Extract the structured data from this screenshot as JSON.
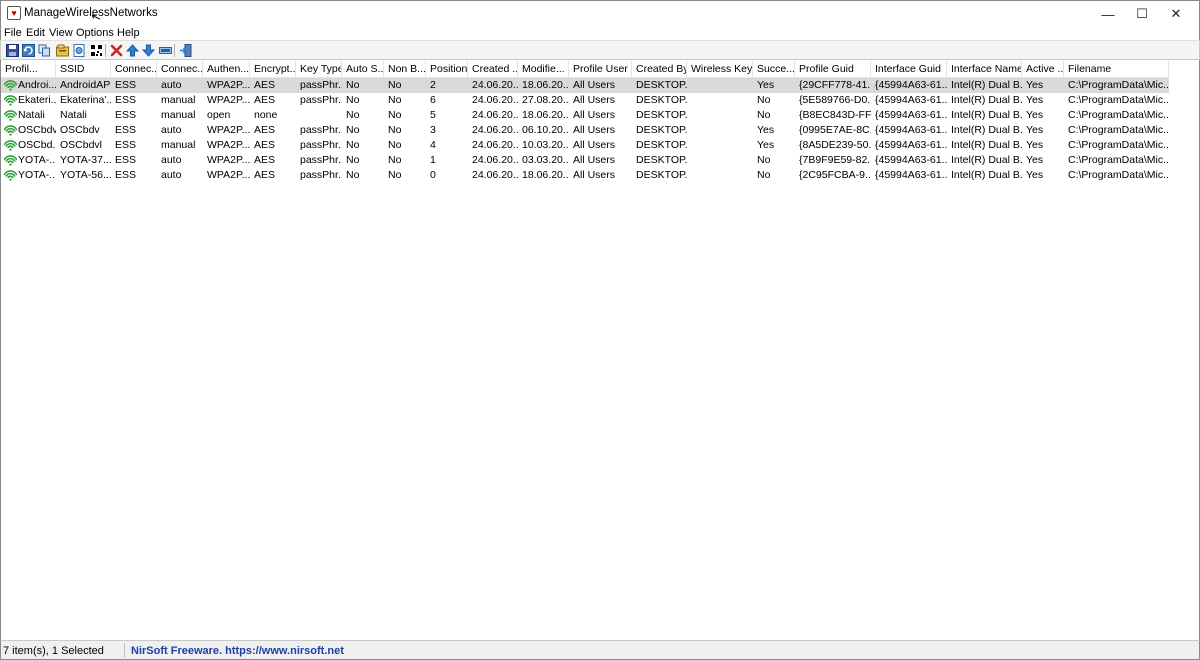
{
  "window": {
    "title": "ManageWirelessNetworks",
    "minimize_glyph": "—",
    "maximize_glyph": "☐",
    "close_glyph": "✕"
  },
  "menu": [
    "File",
    "Edit",
    "View",
    "Options",
    "Help"
  ],
  "toolbar": {
    "icons": [
      "save-icon",
      "refresh-icon",
      "copy-icon",
      "properties-icon",
      "html-report-icon",
      "qr-code-icon",
      "delete-icon",
      "move-up-icon",
      "move-down-icon",
      "connect-icon",
      "exit-icon"
    ]
  },
  "columns": [
    "Profil...",
    "SSID",
    "Connec...",
    "Connec...",
    "Authen...",
    "Encrypt...",
    "Key Type",
    "Auto S...",
    "Non B...",
    "Position",
    "Created ...",
    "Modifie...",
    "Profile User",
    "Created By",
    "Wireless Key",
    "Succe...",
    "Profile Guid",
    "Interface Guid",
    "Interface Name",
    "Active ...",
    "Filename"
  ],
  "rows": [
    {
      "selected": true,
      "cells": [
        "Androi...",
        "AndroidAP",
        "ESS",
        "auto",
        "WPA2P...",
        "AES",
        "passPhr...",
        "No",
        "No",
        "2",
        "24.06.20...",
        "18.06.20...",
        "All Users",
        "DESKTOP...",
        "",
        "Yes",
        "{29CFF778-41...",
        "{45994A63-61...",
        "Intel(R) Dual B...",
        "Yes",
        "C:\\ProgramData\\Mic..."
      ]
    },
    {
      "selected": false,
      "cells": [
        "Ekateri...",
        "Ekaterina'...",
        "ESS",
        "manual",
        "WPA2P...",
        "AES",
        "passPhr...",
        "No",
        "No",
        "6",
        "24.06.20...",
        "27.08.20...",
        "All Users",
        "DESKTOP...",
        "",
        "No",
        "{5E589766-D0...",
        "{45994A63-61...",
        "Intel(R) Dual B...",
        "Yes",
        "C:\\ProgramData\\Mic..."
      ]
    },
    {
      "selected": false,
      "cells": [
        "Natali",
        "Natali",
        "ESS",
        "manual",
        "open",
        "none",
        "",
        "No",
        "No",
        "5",
        "24.06.20...",
        "18.06.20...",
        "All Users",
        "DESKTOP...",
        "",
        "No",
        "{B8EC843D-FF...",
        "{45994A63-61...",
        "Intel(R) Dual B...",
        "Yes",
        "C:\\ProgramData\\Mic..."
      ]
    },
    {
      "selected": false,
      "cells": [
        "OSCbdv",
        "OSCbdv",
        "ESS",
        "auto",
        "WPA2P...",
        "AES",
        "passPhr...",
        "No",
        "No",
        "3",
        "24.06.20...",
        "06.10.20...",
        "All Users",
        "DESKTOP...",
        "",
        "Yes",
        "{0995E7AE-8C...",
        "{45994A63-61...",
        "Intel(R) Dual B...",
        "Yes",
        "C:\\ProgramData\\Mic..."
      ]
    },
    {
      "selected": false,
      "cells": [
        "OSCbd...",
        "OSCbdvl",
        "ESS",
        "manual",
        "WPA2P...",
        "AES",
        "passPhr...",
        "No",
        "No",
        "4",
        "24.06.20...",
        "10.03.20...",
        "All Users",
        "DESKTOP...",
        "",
        "Yes",
        "{8A5DE239-50...",
        "{45994A63-61...",
        "Intel(R) Dual B...",
        "Yes",
        "C:\\ProgramData\\Mic..."
      ]
    },
    {
      "selected": false,
      "cells": [
        "YOTA-...",
        "YOTA-37...",
        "ESS",
        "auto",
        "WPA2P...",
        "AES",
        "passPhr...",
        "No",
        "No",
        "1",
        "24.06.20...",
        "03.03.20...",
        "All Users",
        "DESKTOP...",
        "",
        "No",
        "{7B9F9E59-82...",
        "{45994A63-61...",
        "Intel(R) Dual B...",
        "Yes",
        "C:\\ProgramData\\Mic..."
      ]
    },
    {
      "selected": false,
      "cells": [
        "YOTA-...",
        "YOTA-56...",
        "ESS",
        "auto",
        "WPA2P...",
        "AES",
        "passPhr...",
        "No",
        "No",
        "0",
        "24.06.20...",
        "18.06.20...",
        "All Users",
        "DESKTOP...",
        "",
        "No",
        "{2C95FCBA-9...",
        "{45994A63-61...",
        "Intel(R) Dual B...",
        "Yes",
        "C:\\ProgramData\\Mic..."
      ]
    }
  ],
  "status": {
    "count": "7 item(s), 1 Selected",
    "credit": "NirSoft Freeware. https://www.nirsoft.net"
  },
  "colors": {
    "wifi_icon": "#2e9e3a",
    "selected_row": "#d9d9d9",
    "credit_link": "#1b3fa8"
  }
}
